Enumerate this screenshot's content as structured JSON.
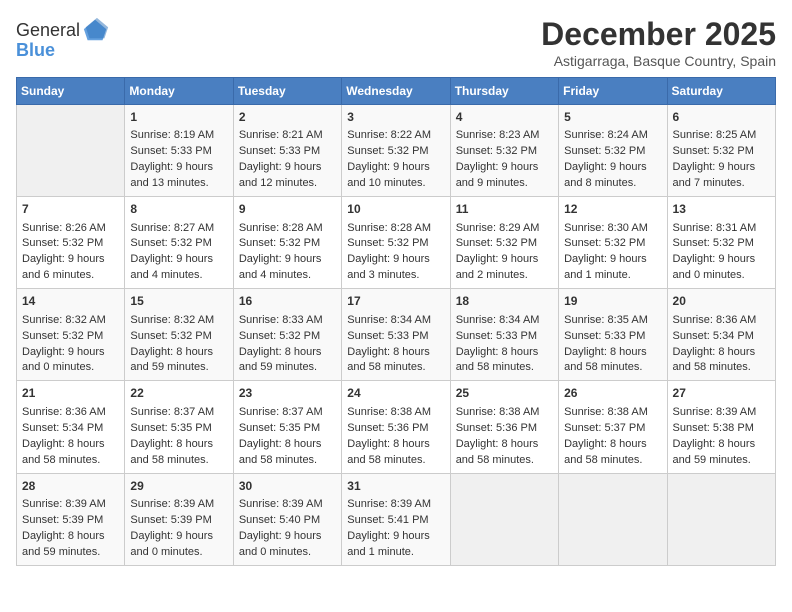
{
  "header": {
    "logo_line1": "General",
    "logo_line2": "Blue",
    "month": "December 2025",
    "location": "Astigarraga, Basque Country, Spain"
  },
  "weekdays": [
    "Sunday",
    "Monday",
    "Tuesday",
    "Wednesday",
    "Thursday",
    "Friday",
    "Saturday"
  ],
  "weeks": [
    [
      {
        "day": "",
        "content": ""
      },
      {
        "day": "1",
        "content": "Sunrise: 8:19 AM\nSunset: 5:33 PM\nDaylight: 9 hours\nand 13 minutes."
      },
      {
        "day": "2",
        "content": "Sunrise: 8:21 AM\nSunset: 5:33 PM\nDaylight: 9 hours\nand 12 minutes."
      },
      {
        "day": "3",
        "content": "Sunrise: 8:22 AM\nSunset: 5:32 PM\nDaylight: 9 hours\nand 10 minutes."
      },
      {
        "day": "4",
        "content": "Sunrise: 8:23 AM\nSunset: 5:32 PM\nDaylight: 9 hours\nand 9 minutes."
      },
      {
        "day": "5",
        "content": "Sunrise: 8:24 AM\nSunset: 5:32 PM\nDaylight: 9 hours\nand 8 minutes."
      },
      {
        "day": "6",
        "content": "Sunrise: 8:25 AM\nSunset: 5:32 PM\nDaylight: 9 hours\nand 7 minutes."
      }
    ],
    [
      {
        "day": "7",
        "content": "Sunrise: 8:26 AM\nSunset: 5:32 PM\nDaylight: 9 hours\nand 6 minutes."
      },
      {
        "day": "8",
        "content": "Sunrise: 8:27 AM\nSunset: 5:32 PM\nDaylight: 9 hours\nand 4 minutes."
      },
      {
        "day": "9",
        "content": "Sunrise: 8:28 AM\nSunset: 5:32 PM\nDaylight: 9 hours\nand 4 minutes."
      },
      {
        "day": "10",
        "content": "Sunrise: 8:28 AM\nSunset: 5:32 PM\nDaylight: 9 hours\nand 3 minutes."
      },
      {
        "day": "11",
        "content": "Sunrise: 8:29 AM\nSunset: 5:32 PM\nDaylight: 9 hours\nand 2 minutes."
      },
      {
        "day": "12",
        "content": "Sunrise: 8:30 AM\nSunset: 5:32 PM\nDaylight: 9 hours\nand 1 minute."
      },
      {
        "day": "13",
        "content": "Sunrise: 8:31 AM\nSunset: 5:32 PM\nDaylight: 9 hours\nand 0 minutes."
      }
    ],
    [
      {
        "day": "14",
        "content": "Sunrise: 8:32 AM\nSunset: 5:32 PM\nDaylight: 9 hours\nand 0 minutes."
      },
      {
        "day": "15",
        "content": "Sunrise: 8:32 AM\nSunset: 5:32 PM\nDaylight: 8 hours\nand 59 minutes."
      },
      {
        "day": "16",
        "content": "Sunrise: 8:33 AM\nSunset: 5:32 PM\nDaylight: 8 hours\nand 59 minutes."
      },
      {
        "day": "17",
        "content": "Sunrise: 8:34 AM\nSunset: 5:33 PM\nDaylight: 8 hours\nand 58 minutes."
      },
      {
        "day": "18",
        "content": "Sunrise: 8:34 AM\nSunset: 5:33 PM\nDaylight: 8 hours\nand 58 minutes."
      },
      {
        "day": "19",
        "content": "Sunrise: 8:35 AM\nSunset: 5:33 PM\nDaylight: 8 hours\nand 58 minutes."
      },
      {
        "day": "20",
        "content": "Sunrise: 8:36 AM\nSunset: 5:34 PM\nDaylight: 8 hours\nand 58 minutes."
      }
    ],
    [
      {
        "day": "21",
        "content": "Sunrise: 8:36 AM\nSunset: 5:34 PM\nDaylight: 8 hours\nand 58 minutes."
      },
      {
        "day": "22",
        "content": "Sunrise: 8:37 AM\nSunset: 5:35 PM\nDaylight: 8 hours\nand 58 minutes."
      },
      {
        "day": "23",
        "content": "Sunrise: 8:37 AM\nSunset: 5:35 PM\nDaylight: 8 hours\nand 58 minutes."
      },
      {
        "day": "24",
        "content": "Sunrise: 8:38 AM\nSunset: 5:36 PM\nDaylight: 8 hours\nand 58 minutes."
      },
      {
        "day": "25",
        "content": "Sunrise: 8:38 AM\nSunset: 5:36 PM\nDaylight: 8 hours\nand 58 minutes."
      },
      {
        "day": "26",
        "content": "Sunrise: 8:38 AM\nSunset: 5:37 PM\nDaylight: 8 hours\nand 58 minutes."
      },
      {
        "day": "27",
        "content": "Sunrise: 8:39 AM\nSunset: 5:38 PM\nDaylight: 8 hours\nand 59 minutes."
      }
    ],
    [
      {
        "day": "28",
        "content": "Sunrise: 8:39 AM\nSunset: 5:39 PM\nDaylight: 8 hours\nand 59 minutes."
      },
      {
        "day": "29",
        "content": "Sunrise: 8:39 AM\nSunset: 5:39 PM\nDaylight: 9 hours\nand 0 minutes."
      },
      {
        "day": "30",
        "content": "Sunrise: 8:39 AM\nSunset: 5:40 PM\nDaylight: 9 hours\nand 0 minutes."
      },
      {
        "day": "31",
        "content": "Sunrise: 8:39 AM\nSunset: 5:41 PM\nDaylight: 9 hours\nand 1 minute."
      },
      {
        "day": "",
        "content": ""
      },
      {
        "day": "",
        "content": ""
      },
      {
        "day": "",
        "content": ""
      }
    ]
  ]
}
